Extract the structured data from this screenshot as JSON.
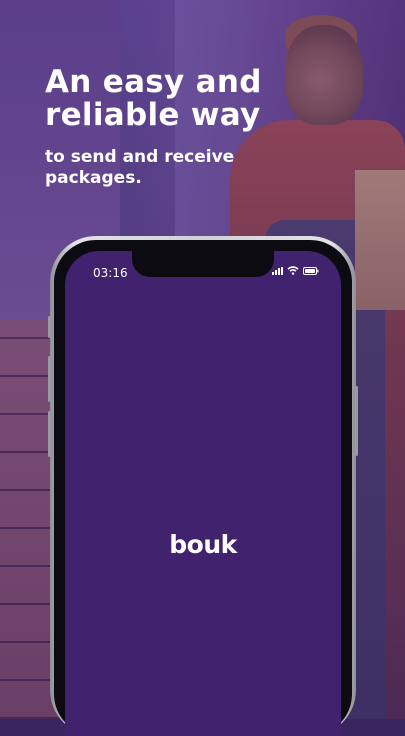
{
  "headline": {
    "line_1": "An easy and",
    "line_2": "reliable way",
    "subline": "to send and receive packages."
  },
  "phone": {
    "status_time": "03:16",
    "status_icons": [
      "signal-icon",
      "wifi-icon",
      "battery-icon"
    ],
    "brand_logo": "bouk",
    "screen_color": "#40226f"
  },
  "colors": {
    "brand_purple": "#40226f",
    "text": "#ffffff"
  }
}
